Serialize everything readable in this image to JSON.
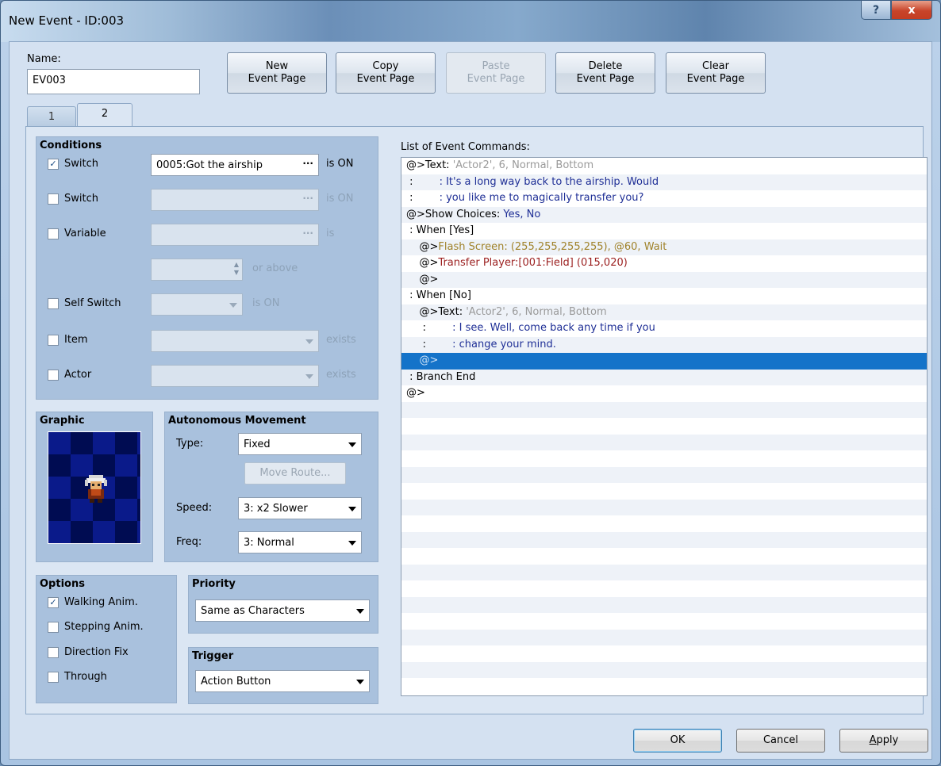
{
  "window": {
    "title": "New Event - ID:003",
    "help_glyph": "?",
    "close_glyph": "x"
  },
  "name": {
    "label": "Name:",
    "value": "EV003"
  },
  "page_buttons": {
    "new": [
      "New",
      "Event Page"
    ],
    "copy": [
      "Copy",
      "Event Page"
    ],
    "paste": [
      "Paste",
      "Event Page"
    ],
    "delete": [
      "Delete",
      "Event Page"
    ],
    "clear": [
      "Clear",
      "Event Page"
    ]
  },
  "tabs": [
    "1",
    "2"
  ],
  "conditions": {
    "title": "Conditions",
    "switch1": {
      "label": "Switch",
      "checked": true,
      "value": "0005:Got the airship",
      "suffix": "is ON"
    },
    "switch2": {
      "label": "Switch",
      "checked": false,
      "value": "",
      "suffix": "is ON"
    },
    "variable": {
      "label": "Variable",
      "checked": false,
      "value": "",
      "suffix": "is",
      "amount": "",
      "amount_suffix": "or above"
    },
    "self_switch": {
      "label": "Self Switch",
      "checked": false,
      "value": "",
      "suffix": "is ON"
    },
    "item": {
      "label": "Item",
      "checked": false,
      "value": "",
      "suffix": "exists"
    },
    "actor": {
      "label": "Actor",
      "checked": false,
      "value": "",
      "suffix": "exists"
    }
  },
  "graphic": {
    "title": "Graphic"
  },
  "autonomous": {
    "title": "Autonomous Movement",
    "type_label": "Type:",
    "type_value": "Fixed",
    "move_route": "Move Route...",
    "speed_label": "Speed:",
    "speed_value": "3: x2 Slower",
    "freq_label": "Freq:",
    "freq_value": "3: Normal"
  },
  "options": {
    "title": "Options",
    "walking": {
      "label": "Walking Anim.",
      "checked": true
    },
    "stepping": {
      "label": "Stepping Anim.",
      "checked": false
    },
    "direction": {
      "label": "Direction Fix",
      "checked": false
    },
    "through": {
      "label": "Through",
      "checked": false
    }
  },
  "priority": {
    "title": "Priority",
    "value": "Same as Characters"
  },
  "trigger": {
    "title": "Trigger",
    "value": "Action Button"
  },
  "commands": {
    "label": "List of Event Commands:",
    "rows": [
      [
        {
          "t": "@>Text: ",
          "c": ""
        },
        {
          "t": "'Actor2', 6, Normal, Bottom",
          "c": "c-gray"
        }
      ],
      [
        {
          "t": " :        ",
          "c": ""
        },
        {
          "t": ": It's a long way back to the airship. Would",
          "c": "c-blue"
        }
      ],
      [
        {
          "t": " :        ",
          "c": ""
        },
        {
          "t": ": you like me to magically transfer you?",
          "c": "c-blue"
        }
      ],
      [
        {
          "t": "@>Show Choices: ",
          "c": ""
        },
        {
          "t": "Yes, No",
          "c": "c-blue"
        }
      ],
      [
        {
          "t": " : When [Yes]",
          "c": ""
        }
      ],
      [
        {
          "t": "    @>",
          "c": ""
        },
        {
          "t": "Flash Screen: (255,255,255,255), @60, Wait",
          "c": "c-olive"
        }
      ],
      [
        {
          "t": "    @>",
          "c": ""
        },
        {
          "t": "Transfer Player:[001:Field] (015,020)",
          "c": "c-red"
        }
      ],
      [
        {
          "t": "    @>",
          "c": ""
        }
      ],
      [
        {
          "t": " : When [No]",
          "c": ""
        }
      ],
      [
        {
          "t": "    @>Text: ",
          "c": ""
        },
        {
          "t": "'Actor2', 6, Normal, Bottom",
          "c": "c-gray"
        }
      ],
      [
        {
          "t": "     :        ",
          "c": ""
        },
        {
          "t": ": I see. Well, come back any time if you",
          "c": "c-blue"
        }
      ],
      [
        {
          "t": "     :        ",
          "c": ""
        },
        {
          "t": ": change your mind.",
          "c": "c-blue"
        }
      ],
      [
        {
          "t": "    @>",
          "c": ""
        }
      ],
      [
        {
          "t": " : Branch End",
          "c": ""
        }
      ],
      [
        {
          "t": "@>",
          "c": ""
        }
      ]
    ],
    "selected_index": 12,
    "empty_rows": 18
  },
  "footer": {
    "ok": "OK",
    "cancel": "Cancel",
    "apply_first": "A",
    "apply_rest": "pply"
  }
}
